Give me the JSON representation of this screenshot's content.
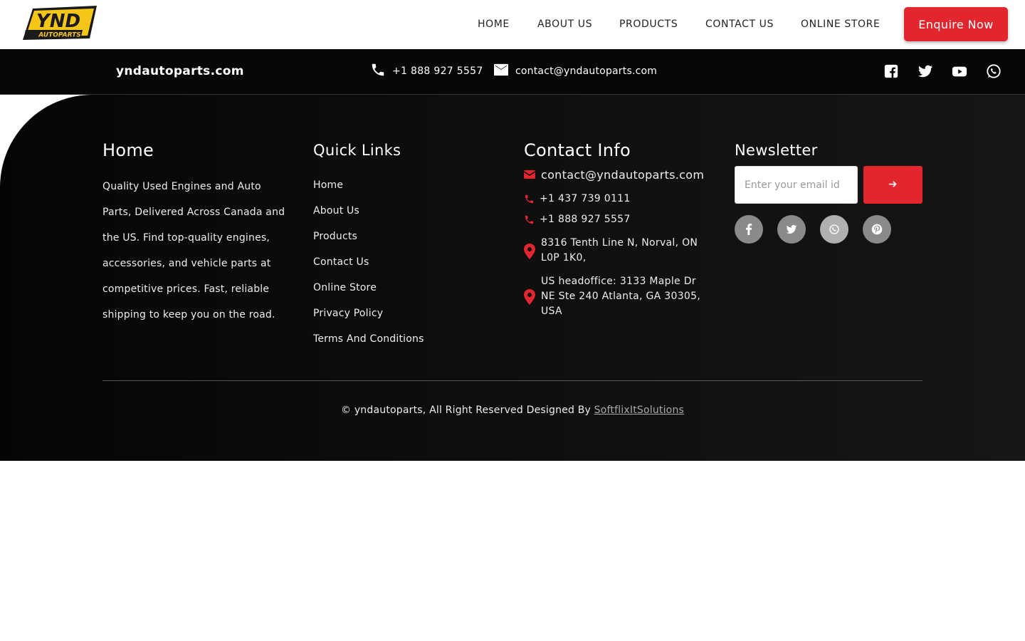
{
  "header": {
    "logo_text": "YND",
    "logo_subtext": "AUTOPARTS",
    "nav": [
      {
        "label": "HOME"
      },
      {
        "label": "ABOUT US"
      },
      {
        "label": "PRODUCTS"
      },
      {
        "label": "CONTACT US"
      },
      {
        "label": "ONLINE STORE"
      }
    ],
    "enquire_label": "Enquire Now"
  },
  "topbar": {
    "site": "yndautoparts.com",
    "phone": "+1 888 927 5557",
    "email": "contact@yndautoparts.com",
    "social_icons": [
      "facebook-icon",
      "twitter-icon",
      "youtube-icon",
      "whatsapp-icon"
    ]
  },
  "footer": {
    "about": {
      "title": "Home",
      "text": "Quality Used Engines and Auto Parts, Delivered Across Canada and the US. Find top-quality engines, accessories, and vehicle parts at competitive prices. Fast, reliable shipping to keep you on the road."
    },
    "quick_links": {
      "title": "Quick Links",
      "items": [
        "Home",
        "About Us",
        "Products",
        "Contact Us",
        "Online Store",
        "Privacy Policy",
        "Terms And Conditions"
      ]
    },
    "contact": {
      "title": "Contact Info",
      "email": "contact@yndautoparts.com",
      "phone1": "+1 437 739 0111",
      "phone2": "+1 888 927 5557",
      "address1": "8316 Tenth Line N, Norval, ON L0P 1K0,",
      "address2": "US headoffice: 3133 Maple Dr NE Ste 240 Atlanta, GA 30305, USA"
    },
    "newsletter": {
      "title": "Newsletter",
      "placeholder": "Enter your email id",
      "submit_icon": "arrow-right-icon",
      "social_icons": [
        "facebook-icon",
        "twitter-icon",
        "whatsapp-icon",
        "pinterest-icon"
      ]
    },
    "copyright_prefix": "© yndautoparts, All Right Reserved Designed By",
    "designer": "SoftflixItSolutions"
  },
  "colors": {
    "accent": "#e3262e",
    "logo_yellow": "#f5c518",
    "dark": "#070707"
  }
}
